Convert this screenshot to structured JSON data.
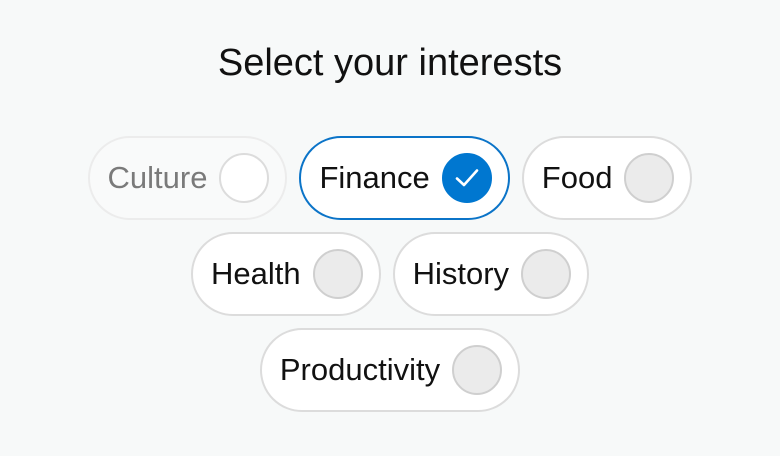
{
  "title": "Select your interests",
  "colors": {
    "accent": "#0077d0",
    "selected_border": "#0b74c8",
    "chip_border": "#dcdcdc",
    "indicator_fill": "#ebebeb",
    "background": "#f7f9f9"
  },
  "chips": [
    {
      "label": "Culture",
      "state": "disabled",
      "selected": false
    },
    {
      "label": "Finance",
      "state": "selected",
      "selected": true,
      "icon": "check-icon"
    },
    {
      "label": "Food",
      "state": "default",
      "selected": false
    },
    {
      "label": "Health",
      "state": "default",
      "selected": false
    },
    {
      "label": "History",
      "state": "default",
      "selected": false
    },
    {
      "label": "Productivity",
      "state": "default",
      "selected": false
    }
  ]
}
